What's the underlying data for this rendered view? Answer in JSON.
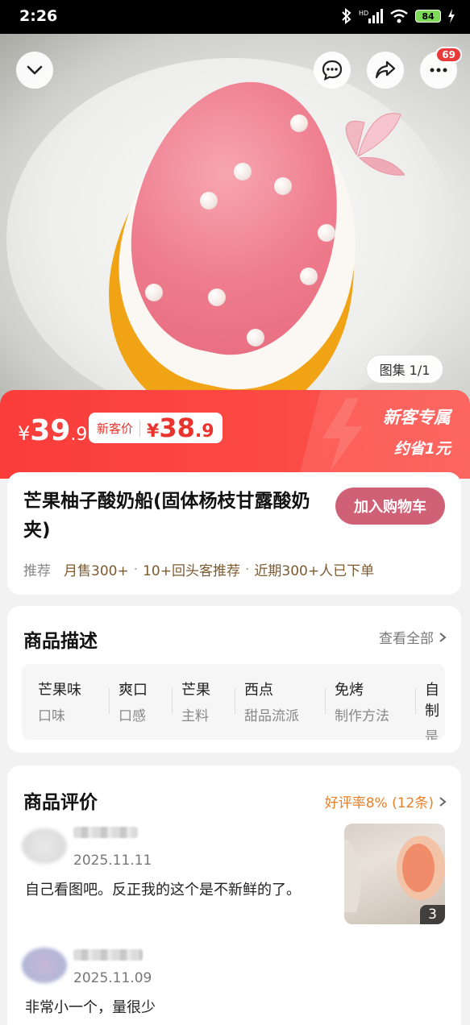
{
  "status_bar": {
    "time": "2:26",
    "battery": "84"
  },
  "hero": {
    "gallery_label": "图集 1/1",
    "cart_badge": "69"
  },
  "price": {
    "currency": "¥",
    "original_int": "39",
    "original_dec": ".9",
    "new_label": "新客价",
    "new_int": "38",
    "new_dec": ".9",
    "promo_title": "新客专属",
    "promo_sub": "约省1元",
    "accent_color": "#fa3c3a"
  },
  "product": {
    "title": "芒果柚子酸奶船(固体杨枝甘露酸奶夹)",
    "add_cart_label": "加入购物车",
    "recommend_label": "推荐",
    "meta": [
      "月售300+",
      "10+回头客推荐",
      "近期300+人已下单"
    ]
  },
  "description": {
    "title": "商品描述",
    "view_all": "查看全部",
    "attributes": [
      {
        "value": "芒果味",
        "key": "口味"
      },
      {
        "value": "爽口",
        "key": "口感"
      },
      {
        "value": "芒果",
        "key": "主料"
      },
      {
        "value": "西点",
        "key": "甜品流派"
      },
      {
        "value": "免烤",
        "key": "制作方法"
      },
      {
        "value": "自制",
        "key": "是否"
      }
    ]
  },
  "reviews": {
    "title": "商品评价",
    "rating_summary": "好评率8% (12条)",
    "items": [
      {
        "date": "2025.11.11",
        "text": "自己看图吧。反正我的这个是不新鲜的了。",
        "photo_count": "3"
      },
      {
        "date": "2025.11.09",
        "text": "非常小一个，量很少"
      }
    ]
  }
}
